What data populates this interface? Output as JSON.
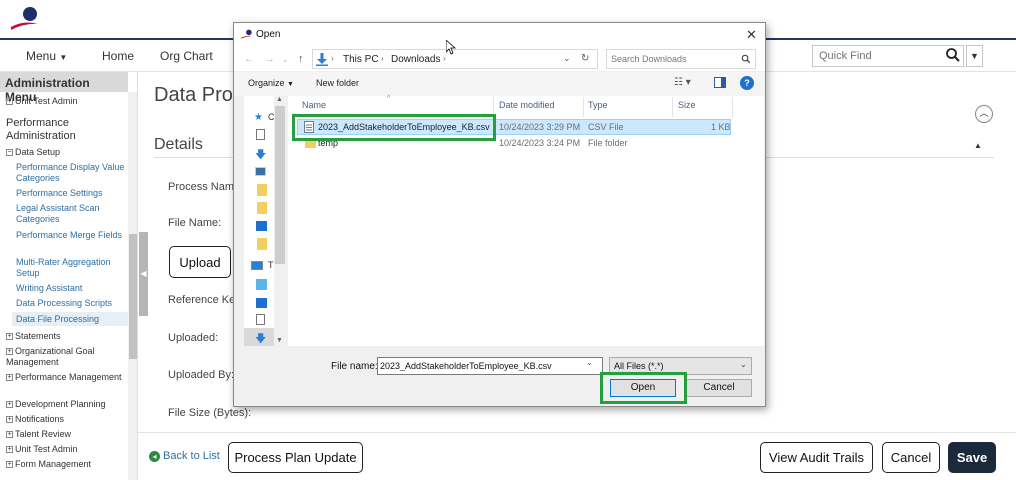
{
  "nav": {
    "menu": "Menu",
    "home": "Home",
    "org_chart": "Org Chart",
    "quick_find_placeholder": "Quick Find"
  },
  "sidebar": {
    "header": "Administration Menu",
    "top_item": "Unit Test Admin",
    "section": "Performance Administration",
    "data_setup": "Data Setup",
    "links": [
      "Performance Display Value Categories",
      "Performance Settings",
      "Legal Assistant Scan Categories",
      "Performance Merge Fields",
      "Multi-Rater Aggregation Setup",
      "Writing Assistant",
      "Data Processing Scripts",
      "Data File Processing"
    ],
    "groups": [
      "Statements",
      "Organizational Goal Management",
      "Performance Management",
      "Development Planning",
      "Notifications",
      "Talent Review",
      "Unit Test Admin",
      "Form Management"
    ]
  },
  "main": {
    "page_title": "Data Proc",
    "details_title": "Details",
    "labels": {
      "process_name": "Process Name",
      "file_name": "File Name:",
      "reference_key": "Reference Key",
      "uploaded": "Uploaded:",
      "uploaded_by": "Uploaded By:",
      "file_size": "File Size (Bytes):"
    },
    "upload_button": "Upload"
  },
  "bottom": {
    "back_link": "Back to List",
    "process_plan_update": "Process Plan Update",
    "view_audit_trails": "View Audit Trails",
    "cancel": "Cancel",
    "save": "Save"
  },
  "dialog": {
    "title": "Open",
    "breadcrumb": [
      "This PC",
      "Downloads"
    ],
    "search_placeholder": "Search Downloads",
    "organize": "Organize",
    "new_folder": "New folder",
    "columns": [
      "Name",
      "Date modified",
      "Type",
      "Size"
    ],
    "nav_initials": [
      "C",
      "T"
    ],
    "files": [
      {
        "name": "2023_AddStakeholderToEmployee_KB.csv",
        "date": "10/24/2023 3:29 PM",
        "type": "CSV File",
        "size": "1 KB",
        "selected": true
      },
      {
        "name": "temp",
        "date": "10/24/2023 3:24 PM",
        "type": "File folder",
        "size": "",
        "selected": false
      }
    ],
    "file_name_label": "File name:",
    "file_name_value": "2023_AddStakeholderToEmployee_KB.csv",
    "file_type": "All Files (*.*)",
    "open_button": "Open",
    "cancel_button": "Cancel"
  },
  "colors": {
    "highlight": "#23a03c",
    "brand_navy": "#1f3864",
    "link": "#2e6fa3",
    "selection": "#cce8ff"
  }
}
